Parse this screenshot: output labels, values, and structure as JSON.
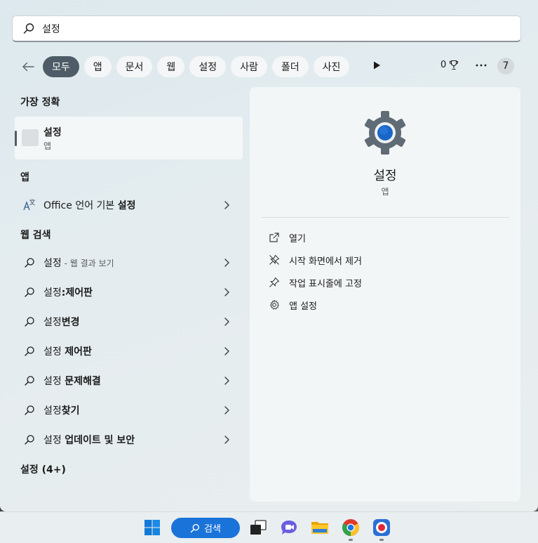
{
  "search": {
    "value": "설정",
    "placeholder": ""
  },
  "filters": {
    "chips": [
      "모두",
      "앱",
      "문서",
      "웹",
      "설정",
      "사람",
      "폴더",
      "사진"
    ],
    "active_index": 0,
    "points": "0",
    "avatar_label": "7"
  },
  "best_match": {
    "title": "가장 정확",
    "item": {
      "name": "설정",
      "type": "앱"
    }
  },
  "apps": {
    "title": "앱",
    "items": [
      {
        "prefix": "Office 언어 기본 ",
        "bold": "설정"
      }
    ]
  },
  "web": {
    "title": "웹 검색",
    "items": [
      {
        "prefix": "설정",
        "bold": "",
        "sub": " - 웹 결과 보기"
      },
      {
        "prefix": "설정",
        "bold": ":제어판",
        "sub": ""
      },
      {
        "prefix": "설정",
        "bold": "변경",
        "sub": ""
      },
      {
        "prefix": "설정 ",
        "bold": "제어판",
        "sub": ""
      },
      {
        "prefix": "설정 ",
        "bold": "문제해결",
        "sub": ""
      },
      {
        "prefix": "설정",
        "bold": "찾기",
        "sub": ""
      },
      {
        "prefix": "설정 ",
        "bold": "업데이트 및 보안",
        "sub": ""
      }
    ]
  },
  "settings_group": {
    "title": "설정 (4+)"
  },
  "preview": {
    "name": "설정",
    "type": "앱",
    "actions": [
      {
        "label": "열기",
        "icon": "open-external-icon"
      },
      {
        "label": "시작 화면에서 제거",
        "icon": "unpin-icon"
      },
      {
        "label": "작업 표시줄에 고정",
        "icon": "pin-icon"
      },
      {
        "label": "앱 설정",
        "icon": "gear-icon"
      }
    ],
    "gear_color": "#5f6b75",
    "gear_center_color": "#1a66c6"
  },
  "taskbar": {
    "search_label": "검색",
    "accent": "#1a73d9",
    "items": [
      "windows-start-icon",
      "task-view-icon",
      "chat-icon",
      "file-explorer-icon",
      "chrome-icon",
      "screen-recorder-icon"
    ]
  }
}
